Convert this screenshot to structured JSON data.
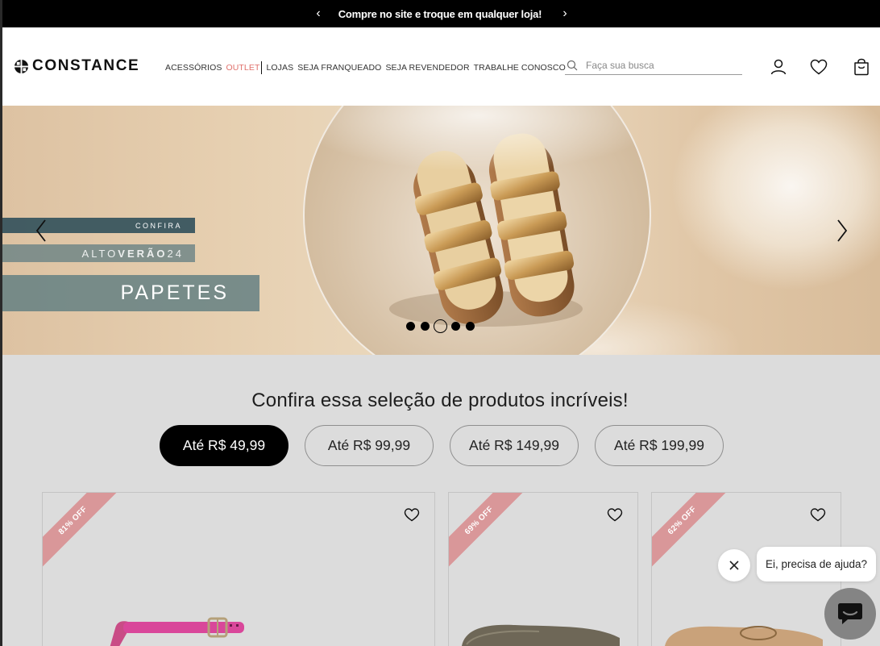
{
  "announcement": {
    "message": "Compre no site e troque em qualquer loja!"
  },
  "header": {
    "logo_text": "CONSTANCE",
    "nav": [
      {
        "label": "ACESSÓRIOS"
      },
      {
        "label": "OUTLET"
      },
      {
        "label": "LOJAS"
      },
      {
        "label": "SEJA FRANQUEADO"
      },
      {
        "label": "SEJA REVENDEDOR"
      },
      {
        "label": "TRABALHE CONOSCO"
      }
    ],
    "search": {
      "placeholder": "Faça sua busca",
      "value": ""
    }
  },
  "banner": {
    "line1": "CONFIRA",
    "line2_light": "ALTO",
    "line2_bold": "VERÃO",
    "line2_suffix": "24",
    "line3": "PAPETES",
    "slide_count": 5,
    "active_slide": 3
  },
  "section": {
    "title": "Confira essa seleção de produtos incríveis!",
    "filters": [
      {
        "label": "Até R$ 49,99",
        "active": true
      },
      {
        "label": "Até R$ 99,99",
        "active": false
      },
      {
        "label": "Até R$ 149,99",
        "active": false
      },
      {
        "label": "Até R$ 199,99",
        "active": false
      }
    ]
  },
  "products": [
    {
      "discount": "81% OFF"
    },
    {
      "discount": "69% OFF"
    },
    {
      "discount": "62% OFF"
    }
  ],
  "chat": {
    "prompt": "Ei, precisa de ajuda?"
  },
  "colors": {
    "outlet": "#e0716c",
    "ribbon": "#d99799",
    "banner_teal": "#34535c"
  }
}
